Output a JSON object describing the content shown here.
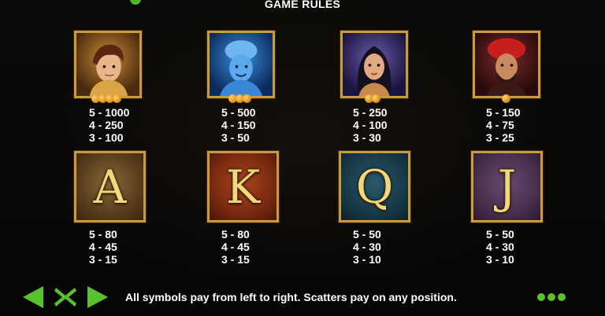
{
  "title": "GAME RULES",
  "symbols_high": [
    {
      "name": "hero",
      "pays": [
        "5 - 1000",
        "4 - 250",
        "3 - 100"
      ],
      "coins": 4
    },
    {
      "name": "genie",
      "pays": [
        "5 - 500",
        "4 - 150",
        "3 - 50"
      ],
      "coins": 3
    },
    {
      "name": "princess",
      "pays": [
        "5 - 250",
        "4 - 100",
        "3 - 30"
      ],
      "coins": 2
    },
    {
      "name": "sultan",
      "pays": [
        "5 - 150",
        "4 - 75",
        "3 - 25"
      ],
      "coins": 1
    }
  ],
  "symbols_low": [
    {
      "letter": "A",
      "pays": [
        "5 - 80",
        "4 - 45",
        "3 - 15"
      ]
    },
    {
      "letter": "K",
      "pays": [
        "5 - 80",
        "4 - 45",
        "3 - 15"
      ]
    },
    {
      "letter": "Q",
      "pays": [
        "5 - 50",
        "4 - 30",
        "3 - 10"
      ]
    },
    {
      "letter": "J",
      "pays": [
        "5 - 50",
        "4 - 30",
        "3 - 10"
      ]
    }
  ],
  "footer": {
    "text": "All symbols pay from left to right. Scatters pay on any position."
  },
  "colors": {
    "accent": "#58c22e",
    "frame": "#c99b3c",
    "glyph": "#f3d77a"
  },
  "icons": {
    "prev": "arrow-left-icon",
    "close": "close-x-icon",
    "next": "arrow-right-icon",
    "menu": "dots-menu-icon"
  }
}
